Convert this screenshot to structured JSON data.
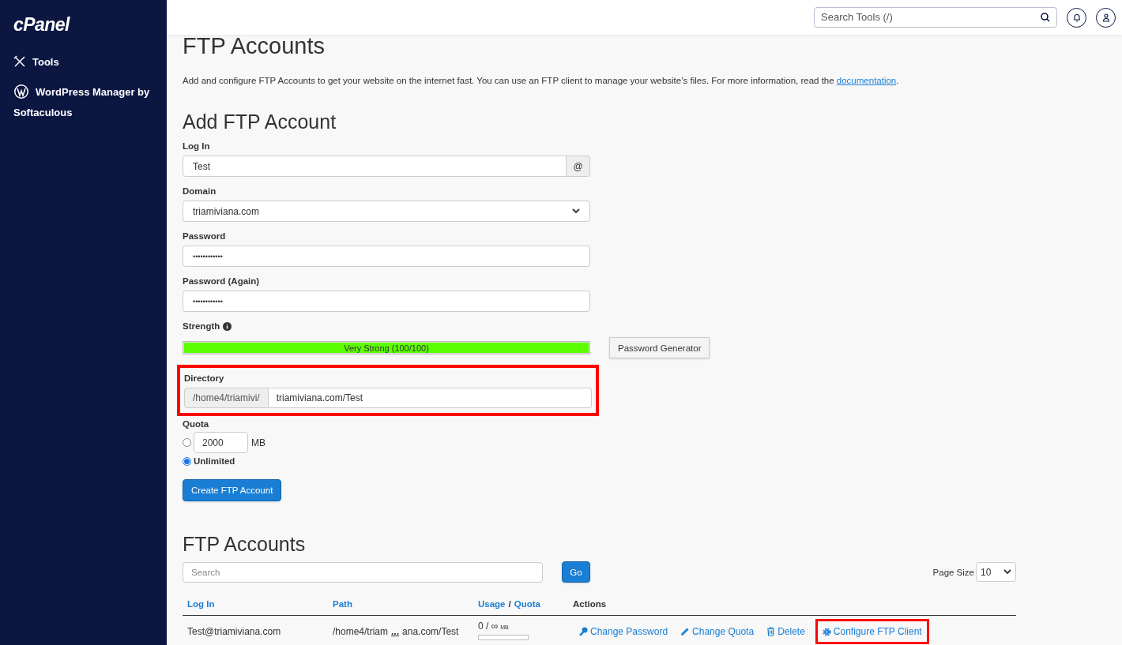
{
  "sidebar": {
    "logo": "cPanel",
    "items": [
      {
        "label": "Tools"
      },
      {
        "label": "WordPress Manager by Softaculous"
      }
    ]
  },
  "header": {
    "search": {
      "placeholder": "Search Tools (/)"
    }
  },
  "page": {
    "title": "FTP Accounts",
    "description": "Add and configure FTP Accounts to get your website on the internet fast. You can use an FTP client to manage your website’s files. For more information, read the ",
    "description_link": "documentation",
    "description_end": "."
  },
  "add_form": {
    "title": "Add FTP Account",
    "login": {
      "label": "Log In",
      "value": "Test",
      "addon": "@"
    },
    "domain": {
      "label": "Domain",
      "value": "triamiviana.com"
    },
    "password": {
      "label": "Password",
      "value": "••••••••••••"
    },
    "password_again": {
      "label": "Password (Again)",
      "value": "••••••••••••"
    },
    "strength": {
      "label": "Strength",
      "text": "Very Strong (100/100)",
      "level": 1
    },
    "generator_button": "Password Generator",
    "directory": {
      "label": "Directory",
      "prefix": "/home4/triamivi/",
      "value": "triamiviana.com/Test",
      "highlighted": true
    },
    "quota": {
      "label": "Quota",
      "options": [
        {
          "kind": "custom",
          "value": "2000",
          "unit": "MB",
          "selected": false
        },
        {
          "kind": "unlimited",
          "label": "Unlimited",
          "selected": true
        }
      ]
    },
    "submit": "Create FTP Account"
  },
  "accounts": {
    "title": "FTP Accounts",
    "search": {
      "placeholder": "Search"
    },
    "go": "Go",
    "page_size": {
      "label": "Page Size",
      "value": "10"
    },
    "columns": [
      {
        "kind": "link",
        "label": "Log In"
      },
      {
        "kind": "link",
        "label": "Path"
      },
      {
        "kind": "usage",
        "label": "Usage",
        "label2": "Quota",
        "sep": "/"
      },
      {
        "kind": "plain",
        "label": "Actions"
      }
    ],
    "rows": [
      {
        "login": "Test@triamiviana.com",
        "path_start": "/home4/triam",
        "path_ellipsis": "...",
        "path_end": "ana.com/Test",
        "usage": "0 / ∞",
        "usage_unit": "MB",
        "level": 0,
        "actions": [
          {
            "label": "Change Password",
            "highlighted": false
          },
          {
            "label": "Change Quota",
            "highlighted": false
          },
          {
            "label": "Delete",
            "highlighted": false
          },
          {
            "label": "Configure FTP Client",
            "highlighted": true
          }
        ]
      }
    ]
  }
}
